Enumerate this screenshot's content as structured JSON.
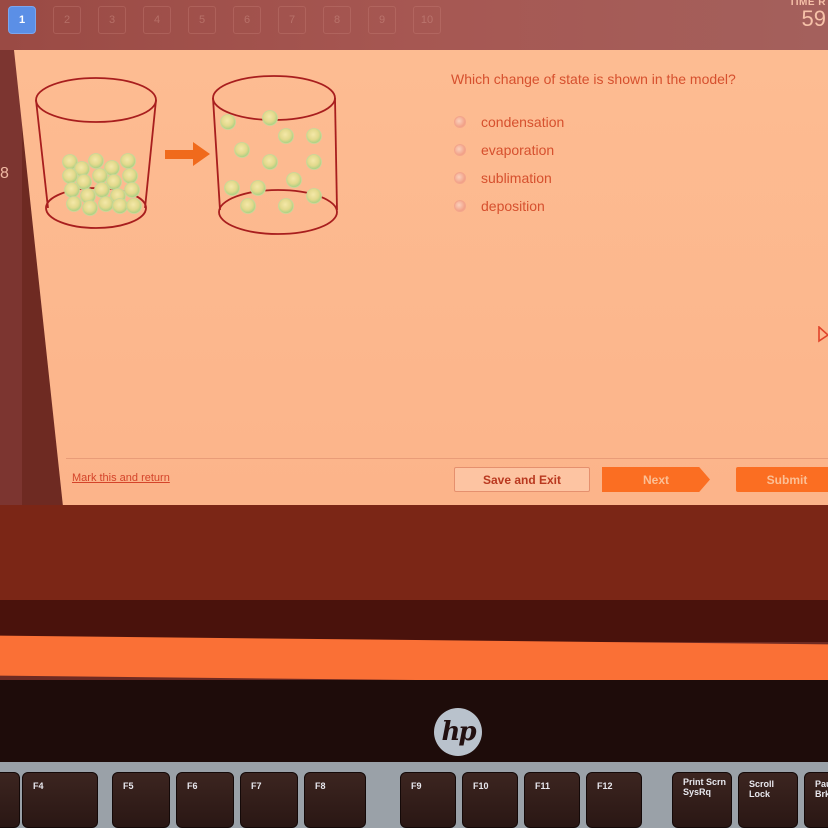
{
  "question_nav": {
    "items": [
      "1",
      "2",
      "3",
      "4",
      "5",
      "6",
      "7",
      "8",
      "9",
      "10"
    ],
    "active_index": 0
  },
  "timer": {
    "label": "TIME R",
    "value": "59"
  },
  "sidebar": {
    "number": "8"
  },
  "question": {
    "text": "Which change of state is shown in the model?",
    "options": [
      {
        "label": "condensation",
        "selected": false
      },
      {
        "label": "evaporation",
        "selected": false
      },
      {
        "label": "sublimation",
        "selected": false
      },
      {
        "label": "deposition",
        "selected": false
      }
    ],
    "diagram": {
      "left_container": "tightly packed particles at bottom",
      "arrow": "right-arrow",
      "right_container": "spread out particles"
    }
  },
  "footer": {
    "mark_link": "Mark this and return",
    "save_exit": "Save and Exit",
    "next": "Next",
    "submit": "Submit"
  },
  "colors": {
    "accent": "#fb6e22",
    "text": "#d6502e",
    "active_nav": "#5b8fe6"
  },
  "laptop": {
    "logo": "hp",
    "keys": [
      {
        "label": "F4"
      },
      {
        "label": "F5"
      },
      {
        "label": "F6"
      },
      {
        "label": "F7"
      },
      {
        "label": "F8"
      },
      {
        "label": "F9"
      },
      {
        "label": "F10"
      },
      {
        "label": "F11"
      },
      {
        "label": "F12"
      },
      {
        "label": "Print Scrn SysRq"
      },
      {
        "label": "Scroll Lock"
      },
      {
        "label": "Pau Brk"
      }
    ]
  }
}
